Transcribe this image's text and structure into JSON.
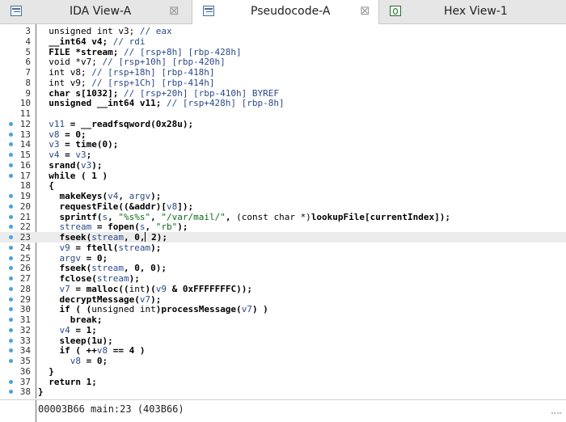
{
  "tabs": [
    {
      "label": "IDA View-A",
      "icon": "ida-view-icon",
      "close": "⊠"
    },
    {
      "label": "Pseudocode-A",
      "icon": "pseudocode-icon",
      "close": "⊠"
    },
    {
      "label": "Hex View-1",
      "icon": "hex-view-icon",
      "close": ""
    }
  ],
  "active_tab": "Pseudocode-A",
  "status": {
    "text": "00003B66 main:23 (403B66)"
  },
  "code_lines": [
    {
      "num": "3",
      "bp": false,
      "tokens": [
        [
          "plain",
          "  unsigned int v3; "
        ],
        [
          "cm",
          "// eax"
        ]
      ]
    },
    {
      "num": "4",
      "bp": false,
      "tokens": [
        [
          "kw",
          "  __int64 v4; "
        ],
        [
          "cm",
          "// rdi"
        ]
      ]
    },
    {
      "num": "5",
      "bp": false,
      "tokens": [
        [
          "kw",
          "  FILE *stream; "
        ],
        [
          "cm",
          "// [rsp+8h] [rbp-428h]"
        ]
      ]
    },
    {
      "num": "6",
      "bp": false,
      "tokens": [
        [
          "plain",
          "  void *v7; "
        ],
        [
          "cm",
          "// [rsp+10h] [rbp-420h]"
        ]
      ]
    },
    {
      "num": "7",
      "bp": false,
      "tokens": [
        [
          "plain",
          "  int v8; "
        ],
        [
          "cm",
          "// [rsp+18h] [rbp-418h]"
        ]
      ]
    },
    {
      "num": "8",
      "bp": false,
      "tokens": [
        [
          "plain",
          "  int v9; "
        ],
        [
          "cm",
          "// [rsp+1Ch] [rbp-414h]"
        ]
      ]
    },
    {
      "num": "9",
      "bp": false,
      "tokens": [
        [
          "kw",
          "  char s[1032]; "
        ],
        [
          "cm",
          "// [rsp+20h] [rbp-410h] BYREF"
        ]
      ]
    },
    {
      "num": "10",
      "bp": false,
      "tokens": [
        [
          "kw",
          "  unsigned __int64 v11; "
        ],
        [
          "cm",
          "// [rsp+428h] [rbp-8h]"
        ]
      ]
    },
    {
      "num": "11",
      "bp": false,
      "tokens": [
        [
          "plain",
          ""
        ]
      ]
    },
    {
      "num": "12",
      "bp": true,
      "tokens": [
        [
          "var",
          "  v11"
        ],
        [
          "kw",
          " = __readfsqword(0x28u);"
        ]
      ]
    },
    {
      "num": "13",
      "bp": true,
      "tokens": [
        [
          "var",
          "  v8"
        ],
        [
          "kw",
          " = 0;"
        ]
      ]
    },
    {
      "num": "14",
      "bp": true,
      "tokens": [
        [
          "var",
          "  v3"
        ],
        [
          "kw",
          " = time(0);"
        ]
      ]
    },
    {
      "num": "15",
      "bp": true,
      "tokens": [
        [
          "var",
          "  v4"
        ],
        [
          "kw",
          " = "
        ],
        [
          "var",
          "v3"
        ],
        [
          "kw",
          ";"
        ]
      ]
    },
    {
      "num": "16",
      "bp": true,
      "tokens": [
        [
          "kw",
          "  srand("
        ],
        [
          "var",
          "v3"
        ],
        [
          "kw",
          ");"
        ]
      ]
    },
    {
      "num": "17",
      "bp": true,
      "tokens": [
        [
          "kw",
          "  while ( 1 )"
        ]
      ]
    },
    {
      "num": "18",
      "bp": false,
      "tokens": [
        [
          "kw",
          "  {"
        ]
      ]
    },
    {
      "num": "19",
      "bp": true,
      "tokens": [
        [
          "kw",
          "    makeKeys("
        ],
        [
          "var",
          "v4"
        ],
        [
          "kw",
          ", "
        ],
        [
          "var",
          "argv"
        ],
        [
          "kw",
          ");"
        ]
      ]
    },
    {
      "num": "20",
      "bp": true,
      "tokens": [
        [
          "kw",
          "    requestFile((&addr)["
        ],
        [
          "var",
          "v8"
        ],
        [
          "kw",
          "]);"
        ]
      ]
    },
    {
      "num": "21",
      "bp": true,
      "tokens": [
        [
          "kw",
          "    sprintf("
        ],
        [
          "var",
          "s"
        ],
        [
          "kw",
          ", "
        ],
        [
          "st",
          "\"%s%s\""
        ],
        [
          "kw",
          ", "
        ],
        [
          "st",
          "\"/var/mail/\""
        ],
        [
          "kw",
          ", "
        ],
        [
          "plain",
          "(const char *)"
        ],
        [
          "kw",
          "lookupFile[currentIndex]);"
        ]
      ]
    },
    {
      "num": "22",
      "bp": true,
      "tokens": [
        [
          "var",
          "    stream"
        ],
        [
          "kw",
          " = fopen("
        ],
        [
          "var",
          "s"
        ],
        [
          "kw",
          ", "
        ],
        [
          "st",
          "\"rb\""
        ],
        [
          "kw",
          ");"
        ]
      ]
    },
    {
      "num": "23",
      "bp": true,
      "hl": true,
      "caret": true,
      "tokens": [
        [
          "kw",
          "    fseek("
        ],
        [
          "var",
          "stream"
        ],
        [
          "kw",
          ", 0,"
        ],
        [
          "caret",
          ""
        ],
        [
          "kw",
          " 2);"
        ]
      ]
    },
    {
      "num": "24",
      "bp": true,
      "tokens": [
        [
          "var",
          "    v9"
        ],
        [
          "kw",
          " = ftell("
        ],
        [
          "var",
          "stream"
        ],
        [
          "kw",
          ");"
        ]
      ]
    },
    {
      "num": "25",
      "bp": true,
      "tokens": [
        [
          "var",
          "    argv"
        ],
        [
          "kw",
          " = 0;"
        ]
      ]
    },
    {
      "num": "26",
      "bp": true,
      "tokens": [
        [
          "kw",
          "    fseek("
        ],
        [
          "var",
          "stream"
        ],
        [
          "kw",
          ", 0, 0);"
        ]
      ]
    },
    {
      "num": "27",
      "bp": true,
      "tokens": [
        [
          "kw",
          "    fclose("
        ],
        [
          "var",
          "stream"
        ],
        [
          "kw",
          ");"
        ]
      ]
    },
    {
      "num": "28",
      "bp": true,
      "tokens": [
        [
          "var",
          "    v7"
        ],
        [
          "kw",
          " = malloc(("
        ],
        [
          "plain",
          "int"
        ],
        [
          "kw",
          ")("
        ],
        [
          "var",
          "v9"
        ],
        [
          "kw",
          " & 0xFFFFFFFC));"
        ]
      ]
    },
    {
      "num": "29",
      "bp": true,
      "tokens": [
        [
          "kw",
          "    decryptMessage("
        ],
        [
          "var",
          "v7"
        ],
        [
          "kw",
          ");"
        ]
      ]
    },
    {
      "num": "30",
      "bp": true,
      "tokens": [
        [
          "kw",
          "    if ( ("
        ],
        [
          "plain",
          "unsigned int"
        ],
        [
          "kw",
          ")processMessage("
        ],
        [
          "var",
          "v7"
        ],
        [
          "kw",
          ") )"
        ]
      ]
    },
    {
      "num": "31",
      "bp": true,
      "tokens": [
        [
          "kw",
          "      break;"
        ]
      ]
    },
    {
      "num": "32",
      "bp": true,
      "tokens": [
        [
          "var",
          "    v4"
        ],
        [
          "kw",
          " = 1;"
        ]
      ]
    },
    {
      "num": "33",
      "bp": true,
      "tokens": [
        [
          "kw",
          "    sleep(1u);"
        ]
      ]
    },
    {
      "num": "34",
      "bp": true,
      "tokens": [
        [
          "kw",
          "    if ( ++"
        ],
        [
          "var",
          "v8"
        ],
        [
          "kw",
          " == 4 )"
        ]
      ]
    },
    {
      "num": "35",
      "bp": true,
      "tokens": [
        [
          "var",
          "      v8"
        ],
        [
          "kw",
          " = 0;"
        ]
      ]
    },
    {
      "num": "36",
      "bp": false,
      "tokens": [
        [
          "kw",
          "  }"
        ]
      ]
    },
    {
      "num": "37",
      "bp": true,
      "tokens": [
        [
          "kw",
          "  return 1;"
        ]
      ]
    },
    {
      "num": "38",
      "bp": true,
      "tokens": [
        [
          "kw",
          "}"
        ]
      ]
    }
  ]
}
